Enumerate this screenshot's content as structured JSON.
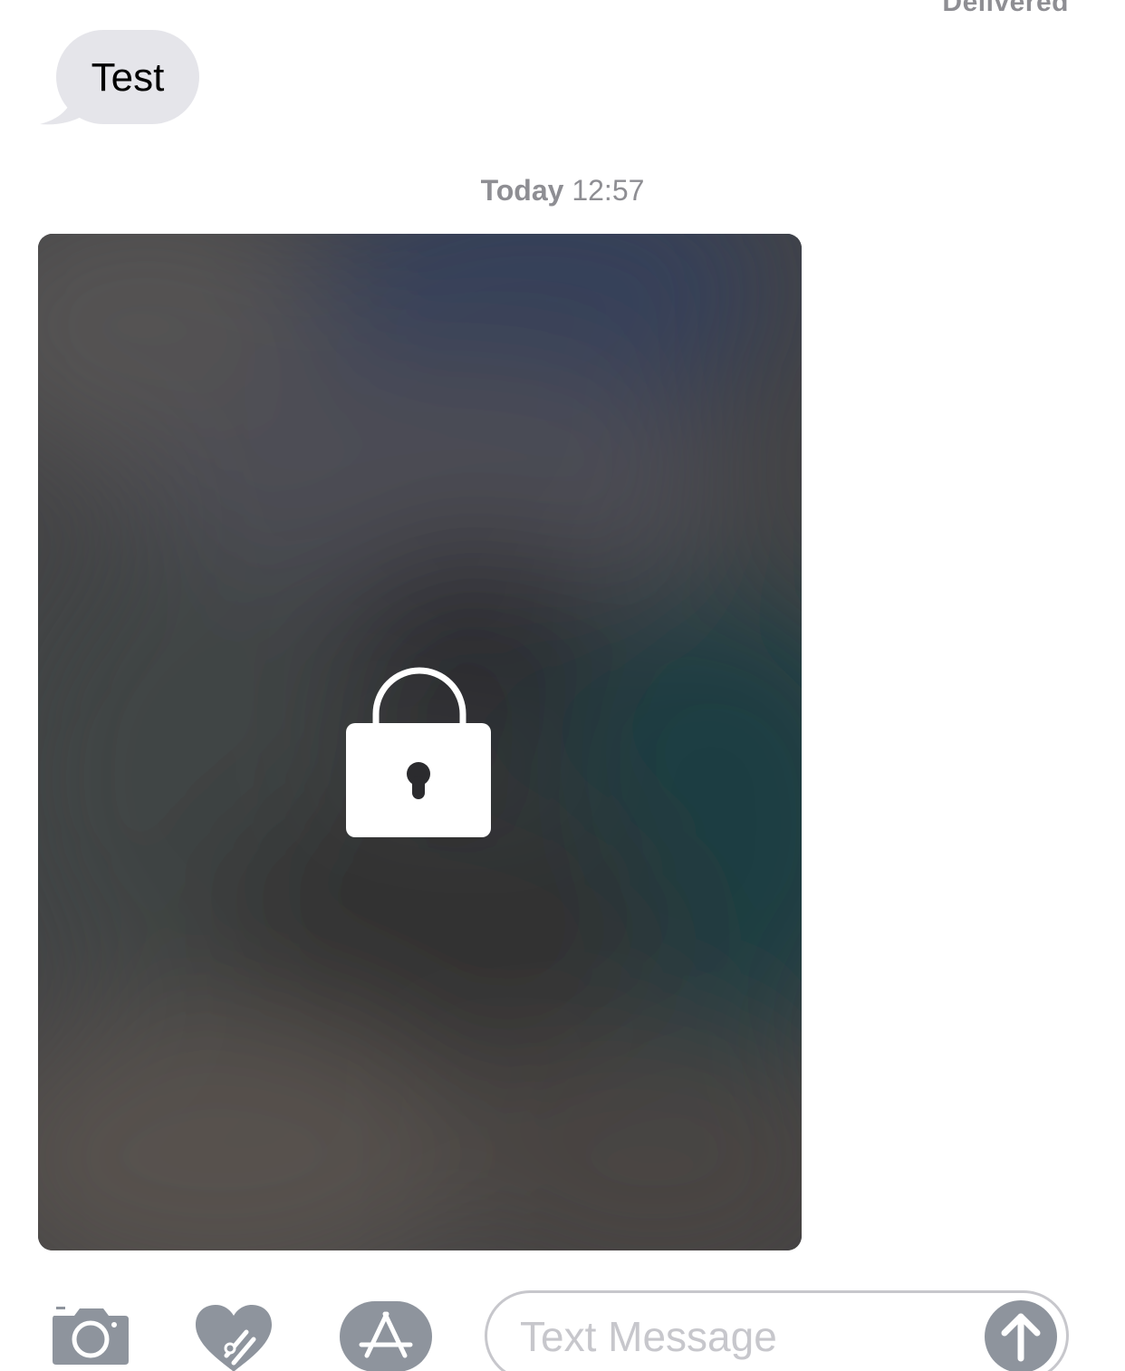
{
  "status": {
    "delivered": "Delivered"
  },
  "incoming_message": {
    "text": "Test"
  },
  "timestamp": {
    "day": "Today",
    "time": "12:57"
  },
  "attachment": {
    "type": "locked-image",
    "icon": "lock-icon"
  },
  "toolbar": {
    "camera_icon": "camera-icon",
    "digital_touch_icon": "digital-touch-heart-icon",
    "app_store_icon": "app-store-icon",
    "send_icon": "send-arrow-icon"
  },
  "composer": {
    "placeholder": "Text Message",
    "value": ""
  },
  "colors": {
    "incoming_bubble": "#e5e5ea",
    "secondary_text": "#8e8e93",
    "toolbar_icon": "#8e949d",
    "field_border": "#c7c7cc"
  }
}
